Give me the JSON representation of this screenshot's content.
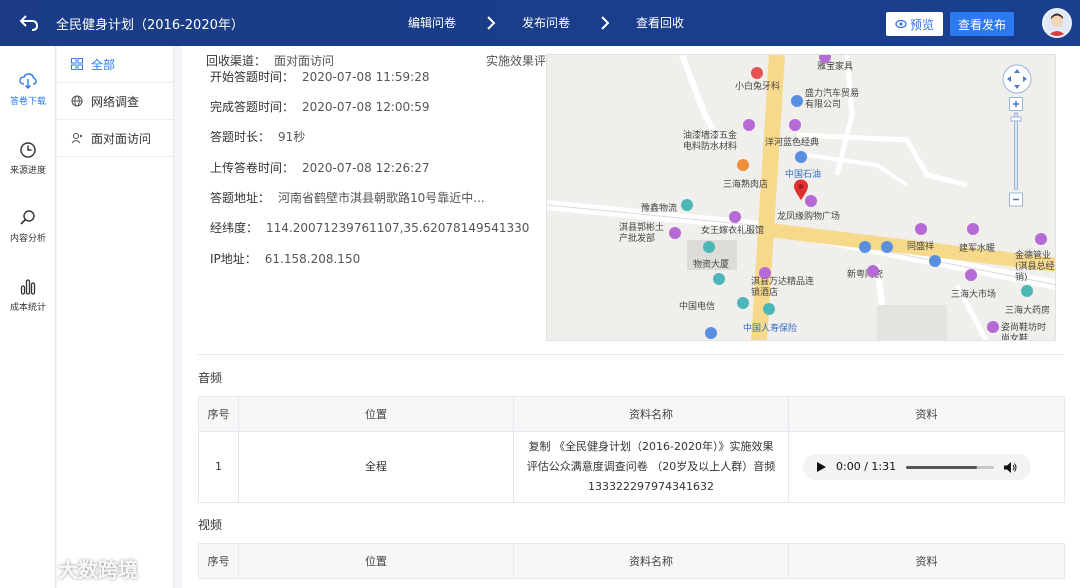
{
  "header": {
    "title": "全民健身计划（2016-2020年）",
    "steps": [
      "编辑问卷",
      "发布问卷",
      "查看回收"
    ],
    "preview_label": "预览",
    "publish_label": "查看发布"
  },
  "leftnav": [
    {
      "label": "答卷下载",
      "icon": "cloud-download-icon"
    },
    {
      "label": "来源进度",
      "icon": "clock-icon"
    },
    {
      "label": "内容分析",
      "icon": "search-icon"
    },
    {
      "label": "成本统计",
      "icon": "bar-chart-icon"
    }
  ],
  "subnav": [
    {
      "label": "全部",
      "icon": "grid-icon"
    },
    {
      "label": "网络调查",
      "icon": "globe-icon"
    },
    {
      "label": "面对面访问",
      "icon": "person-icon"
    }
  ],
  "info": {
    "channel": {
      "label": "回收渠道：",
      "value": "面对面访问"
    },
    "start": {
      "label": "开始答题时间：",
      "value": "2020-07-08 11:59:28"
    },
    "finish": {
      "label": "完成答题时间：",
      "value": "2020-07-08 12:00:59"
    },
    "duration": {
      "label": "答题时长：",
      "value": "91秒"
    },
    "upload": {
      "label": "上传答卷时间：",
      "value": "2020-07-08 12:26:27"
    },
    "address": {
      "label": "答题地址：",
      "value": "河南省鹤壁市淇县朝歌路10号靠近中..."
    },
    "coords": {
      "label": "经纬度：",
      "value": "114.20071239761107,35.62078149541330"
    },
    "ip": {
      "label": "IP地址：",
      "value": "61.158.208.150"
    },
    "cut_text": "实施效果评估"
  },
  "map": {
    "labels": [
      "雅宝家具",
      "小白兔牙科",
      "盛力汽车贸易有限公司",
      "油漆墙漆五金电料防水材料",
      "洋河蓝色经典",
      "中国石油",
      "三海熟肉店",
      "豫鑫物流",
      "龙凤缘购物广场",
      "女王嫁衣礼服馆",
      "淇县郭彬土产批发部",
      "物资大厦",
      "同盛祥",
      "建军水暖",
      "金德管业(淇县总经销)",
      "新粤陶瓷",
      "淇县万达精品连锁酒店",
      "三海大市场",
      "中国电信",
      "三海大药房",
      "中国人寿保险",
      "姿尚鞋坊时尚女鞋"
    ]
  },
  "audio_section": {
    "title": "音频",
    "columns": [
      "序号",
      "位置",
      "资料名称",
      "资料"
    ],
    "rows": [
      {
        "index": "1",
        "position": "全程",
        "name": "复制 《全民健身计划（2016-2020年）》实施效果评估公众满意度调查问卷 （20岁及以上人群）音频1333222979743416​32",
        "time": "0:00 / 1:31"
      }
    ]
  },
  "video_section": {
    "title": "视频",
    "columns": [
      "序号",
      "位置",
      "资料名称",
      "资料"
    ]
  },
  "watermark": "大数跨境",
  "colors": {
    "header": "#1b3c85",
    "accent": "#2b7af1"
  }
}
